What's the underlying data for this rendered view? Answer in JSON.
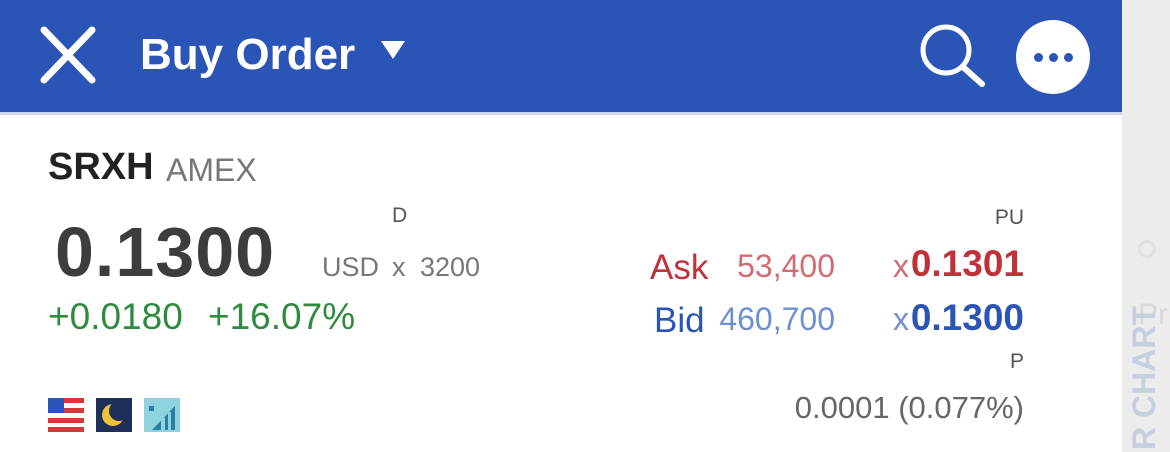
{
  "header": {
    "title": "Buy Order",
    "bg_color": "#2a55b7"
  },
  "instrument": {
    "symbol": "SRXH",
    "exchange": "AMEX"
  },
  "quote": {
    "price_label": "D",
    "price": "0.1300",
    "currency": "USD",
    "x": "x",
    "size": "3200",
    "change": "+0.0180",
    "change_pct": "+16.07%"
  },
  "book": {
    "pu_label": "PU",
    "ask": {
      "label": "Ask",
      "size": "53,400",
      "x": "x",
      "price": "0.1301",
      "color": "#c0323a"
    },
    "bid": {
      "label": "Bid",
      "size": "460,700",
      "x": "x",
      "price": "0.1300",
      "color": "#2a55b7"
    },
    "p_label": "P",
    "spread": "0.0001 (0.077%)"
  },
  "status_icons": [
    "us-flag-icon",
    "moon-icon",
    "bar-chart-icon"
  ],
  "side_panel": {
    "chart_tab": "R CHART",
    "partial_text": "Pr"
  }
}
